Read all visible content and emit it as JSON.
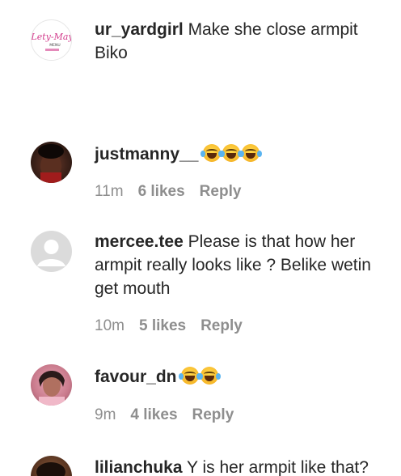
{
  "comments": [
    {
      "username": "ur_yardgirl",
      "text": "Make she close armpit Biko",
      "avatar_logo": "Lety-May"
    },
    {
      "username": "justmanny__",
      "text": "",
      "emoji_count": 3,
      "time": "11m",
      "likes": "6 likes",
      "reply": "Reply"
    },
    {
      "username": "mercee.tee",
      "text": "Please is that how her armpit really looks like ? Belike wetin get mouth",
      "time": "10m",
      "likes": "5 likes",
      "reply": "Reply"
    },
    {
      "username": "favour_dn",
      "text": "",
      "emoji_count": 2,
      "time": "9m",
      "likes": "4 likes",
      "reply": "Reply"
    },
    {
      "username": "lilianchuka",
      "text": "Y is her armpit like that?"
    }
  ],
  "colors": {
    "text": "#262626",
    "meta": "#8e8e8e",
    "emoji": "#f7b82a"
  },
  "icons": {
    "emoji": "face-with-tears-of-joy-icon"
  }
}
